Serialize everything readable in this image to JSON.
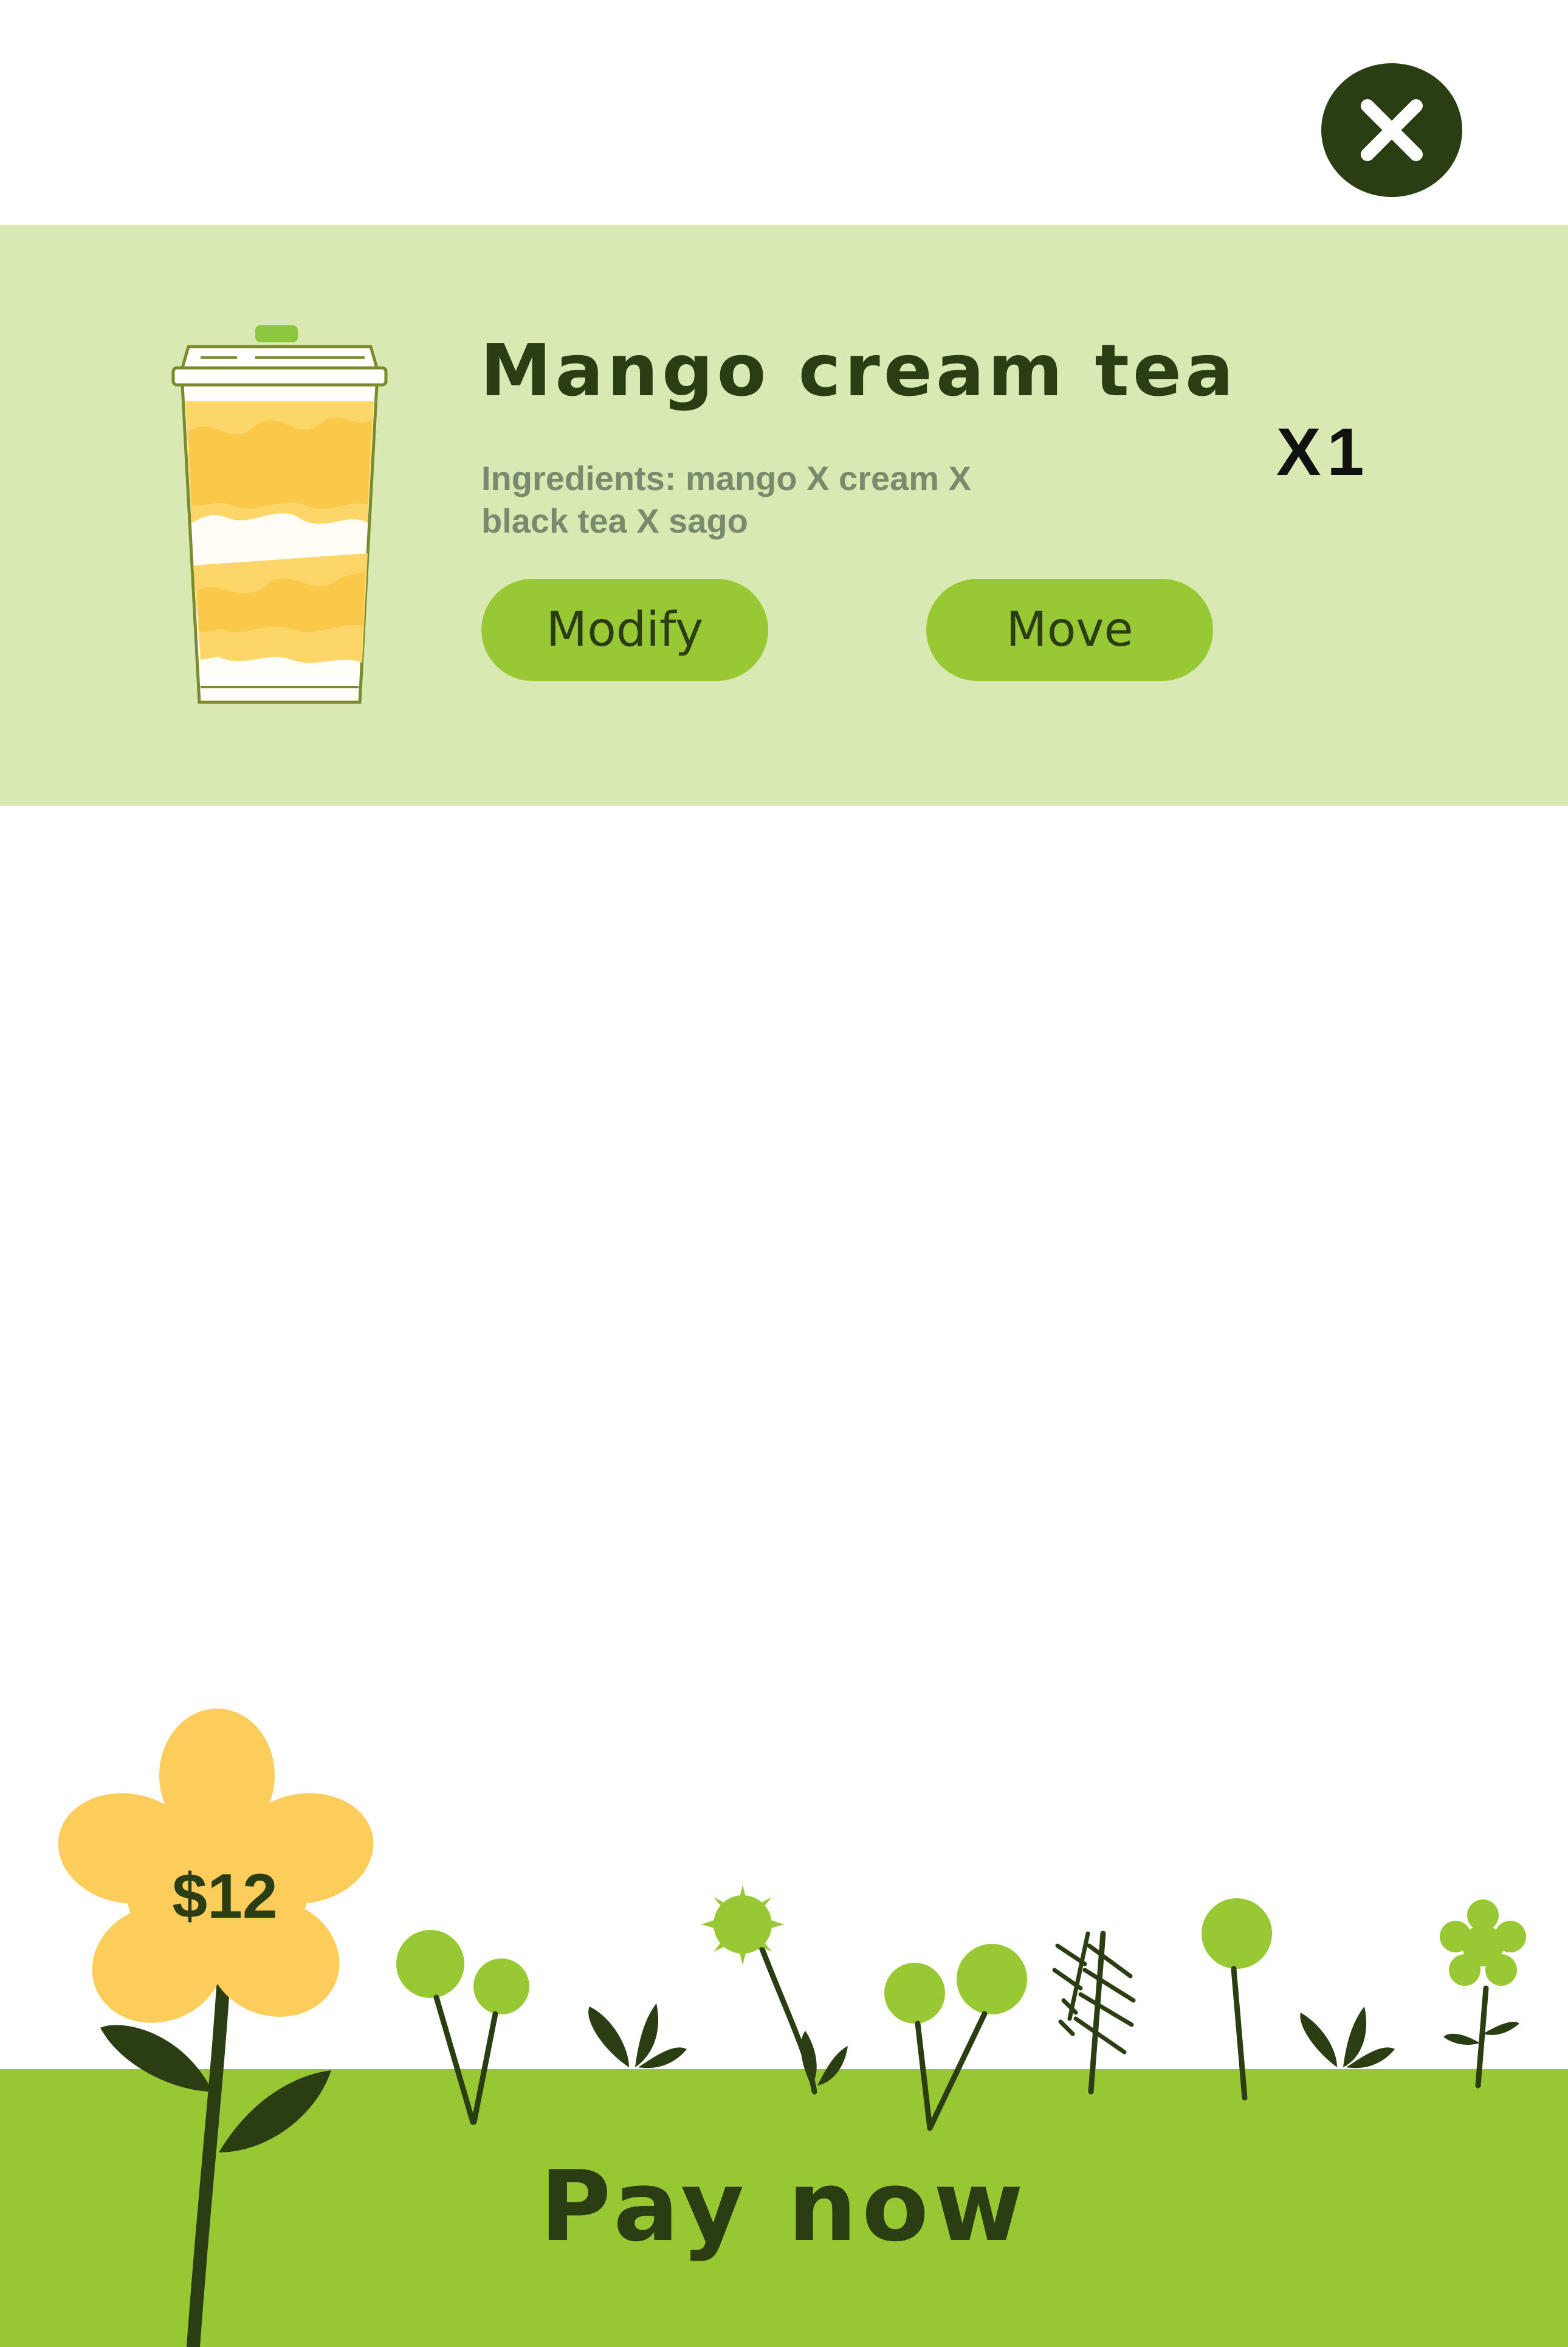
{
  "colors": {
    "dark_green": "#2b3d13",
    "light_green_panel": "#d9e9b4",
    "accent_green": "#97c733",
    "flower_yellow": "#fdcd5c",
    "text_grey": "#7a8a6c"
  },
  "header": {
    "close_icon": "close-icon"
  },
  "cart": {
    "items": [
      {
        "name": "Mango cream tea",
        "ingredients": "Ingredients: mango X cream X black tea X sago",
        "quantity": "X1",
        "image_icon": "cup-icon",
        "modify_label": "Modify",
        "move_label": "Move"
      }
    ]
  },
  "footer": {
    "total": "$12",
    "pay_label": "Pay now"
  }
}
